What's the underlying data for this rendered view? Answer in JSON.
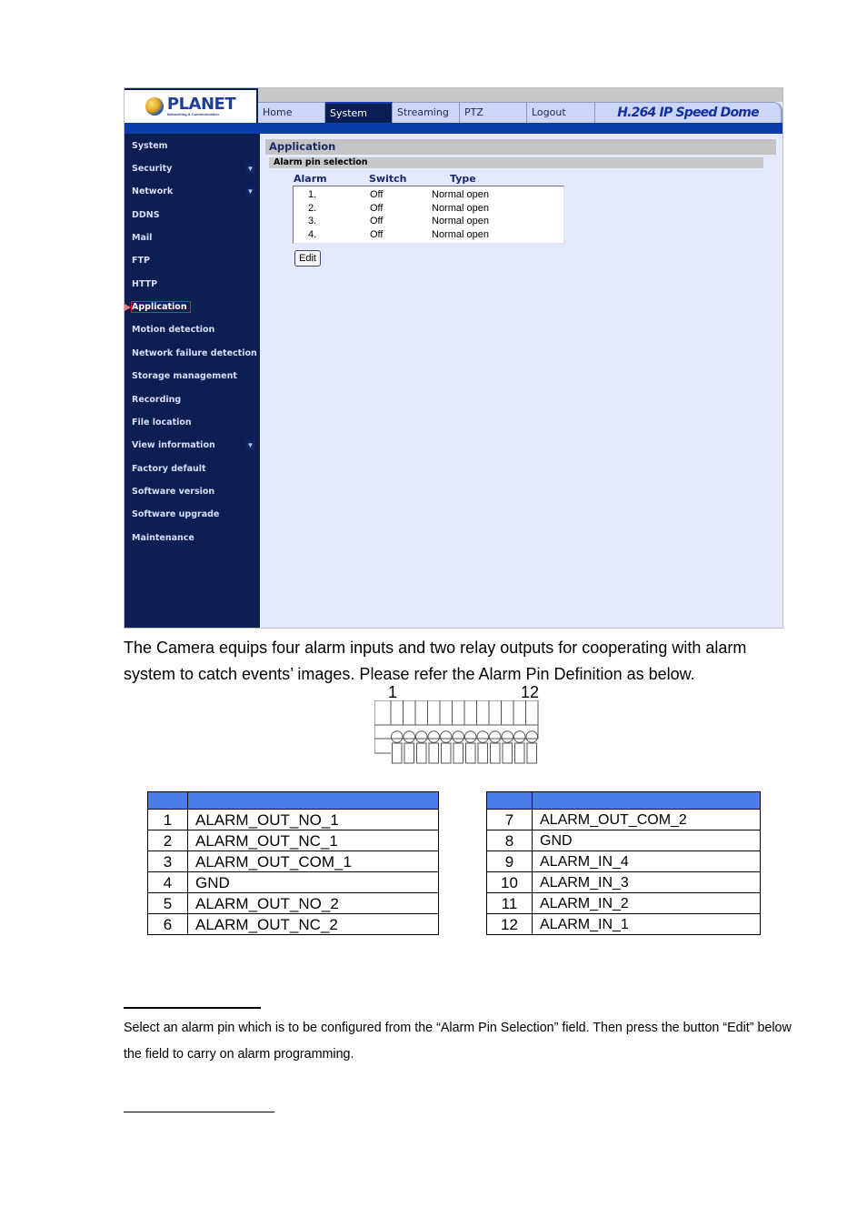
{
  "ui": {
    "logo": {
      "name": "PLANET",
      "tagline": "Networking & Communication"
    },
    "tabs": [
      {
        "label": "Home",
        "active": false
      },
      {
        "label": "System",
        "active": true
      },
      {
        "label": "Streaming",
        "active": false
      },
      {
        "label": "PTZ",
        "active": false
      },
      {
        "label": "Logout",
        "active": false
      }
    ],
    "product_name": "H.264 IP Speed Dome",
    "sidebar": {
      "items": [
        {
          "label": "System",
          "has_submenu": false
        },
        {
          "label": "Security",
          "has_submenu": true
        },
        {
          "label": "Network",
          "has_submenu": true
        },
        {
          "label": "DDNS",
          "has_submenu": false
        },
        {
          "label": "Mail",
          "has_submenu": false
        },
        {
          "label": "FTP",
          "has_submenu": false
        },
        {
          "label": "HTTP",
          "has_submenu": false
        },
        {
          "label": "Application",
          "has_submenu": false,
          "selected": true
        },
        {
          "label": "Motion detection",
          "has_submenu": false
        },
        {
          "label": "Network failure detection",
          "has_submenu": false
        },
        {
          "label": "Storage management",
          "has_submenu": false
        },
        {
          "label": "Recording",
          "has_submenu": false
        },
        {
          "label": "File location",
          "has_submenu": false
        },
        {
          "label": "View information",
          "has_submenu": true
        },
        {
          "label": "Factory default",
          "has_submenu": false
        },
        {
          "label": "Software version",
          "has_submenu": false
        },
        {
          "label": "Software upgrade",
          "has_submenu": false
        },
        {
          "label": "Maintenance",
          "has_submenu": false
        }
      ],
      "submenu_arrow": "▼"
    },
    "content": {
      "section_title": "Application",
      "subsection_title": "Alarm pin selection",
      "columns": [
        "Alarm",
        "Switch",
        "Type"
      ],
      "alarms": [
        {
          "num": "1.",
          "switch": "Off",
          "type": "Normal open"
        },
        {
          "num": "2.",
          "switch": "Off",
          "type": "Normal open"
        },
        {
          "num": "3.",
          "switch": "Off",
          "type": "Normal open"
        },
        {
          "num": "4.",
          "switch": "Off",
          "type": "Normal open"
        }
      ],
      "edit_button": "Edit"
    },
    "colors": {
      "sidebar_bg": "#0c1e52",
      "content_bg": "#e4e9fd",
      "accent_bar": "#0b3ea8",
      "selected_outline": "#e02020"
    }
  },
  "document": {
    "paragraph": "The Camera equips four alarm inputs and two relay outputs for cooperating with alarm system to catch events’ images. Please refer the Alarm Pin Definition as below.",
    "connector": {
      "first_pin_label": "1",
      "last_pin_label": "12",
      "pin_count": 12
    },
    "pin_table_left": [
      {
        "pin": "1",
        "name": "ALARM_OUT_NO_1"
      },
      {
        "pin": "2",
        "name": "ALARM_OUT_NC_1"
      },
      {
        "pin": "3",
        "name": "ALARM_OUT_COM_1"
      },
      {
        "pin": "4",
        "name": "GND"
      },
      {
        "pin": "5",
        "name": "ALARM_OUT_NO_2"
      },
      {
        "pin": "6",
        "name": "ALARM_OUT_NC_2"
      }
    ],
    "pin_table_right": [
      {
        "pin": "7",
        "name": "ALARM_OUT_COM_2"
      },
      {
        "pin": "8",
        "name": "GND"
      },
      {
        "pin": "9",
        "name": "ALARM_IN_4"
      },
      {
        "pin": "10",
        "name": "ALARM_IN_3"
      },
      {
        "pin": "11",
        "name": "ALARM_IN_2"
      },
      {
        "pin": "12",
        "name": "ALARM_IN_1"
      }
    ],
    "table_header_color": "#4d7de8",
    "footnote": "Select an alarm pin which is to be configured from the “Alarm Pin Selection” field. Then press the button “Edit” below the field to carry on alarm programming."
  }
}
